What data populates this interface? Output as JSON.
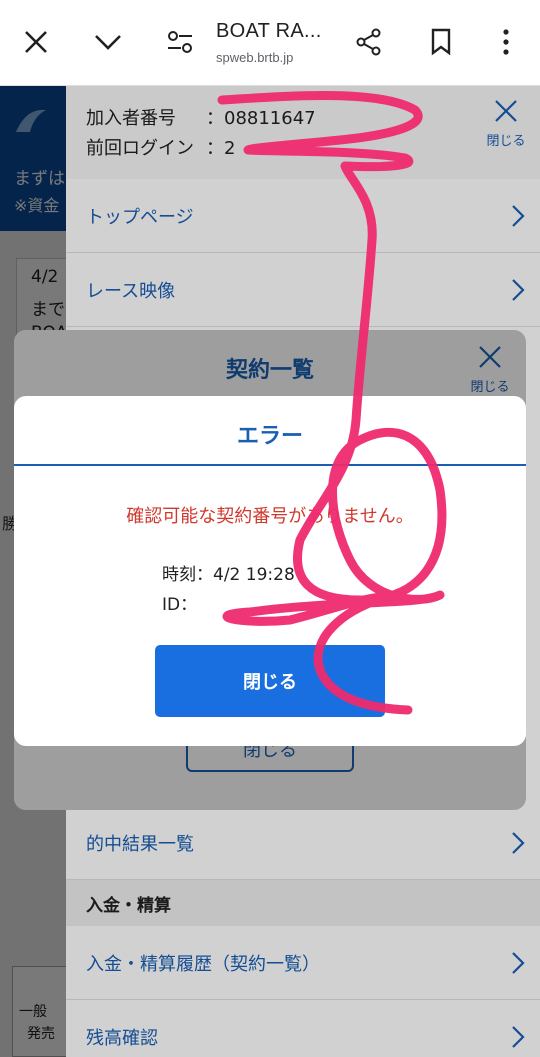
{
  "browser": {
    "title": "BOAT RA...",
    "url": "spweb.brtb.jp",
    "icons": [
      "close-icon",
      "chevron-down-icon",
      "tune-icon",
      "share-icon",
      "bookmark-icon",
      "more-vert-icon"
    ]
  },
  "background_page": {
    "header_line_1": "まずは",
    "header_line_2": "※資金",
    "card_line_1": "4/2",
    "card_line_2": "まで",
    "card_line_3": "BOA",
    "side_text_1": "勝",
    "bottom_text_1": "一般",
    "bottom_text_2": "発売"
  },
  "drawer": {
    "member_label": "加入者番号",
    "member_value": "：08811647",
    "login_label": "前回ログイン",
    "login_value": "：2",
    "close_label": "閉じる",
    "items": [
      {
        "label": "トップページ"
      },
      {
        "label": "レース映像"
      }
    ],
    "lower_items": [
      {
        "label": "的中結果一覧"
      }
    ],
    "section_title": "入金・精算",
    "section_items": [
      {
        "label": "入金・精算履歴（契約一覧）"
      },
      {
        "label": "残高確認"
      }
    ]
  },
  "contract_modal": {
    "title": "契約一覧",
    "close_label": "閉じる",
    "close_button_label": "閉じる"
  },
  "error_dialog": {
    "title": "エラー",
    "message": "確認可能な契約番号がありません。",
    "time_label": "時刻：4/2 19:28",
    "id_label": "ID：",
    "close_button_label": "閉じる"
  },
  "colors": {
    "brand_blue": "#1a5fb4",
    "button_blue": "#1a6fe0",
    "error_red": "#d0392d",
    "scribble_pink": "#ee2a6e",
    "header_blue": "#0a4fa0"
  }
}
